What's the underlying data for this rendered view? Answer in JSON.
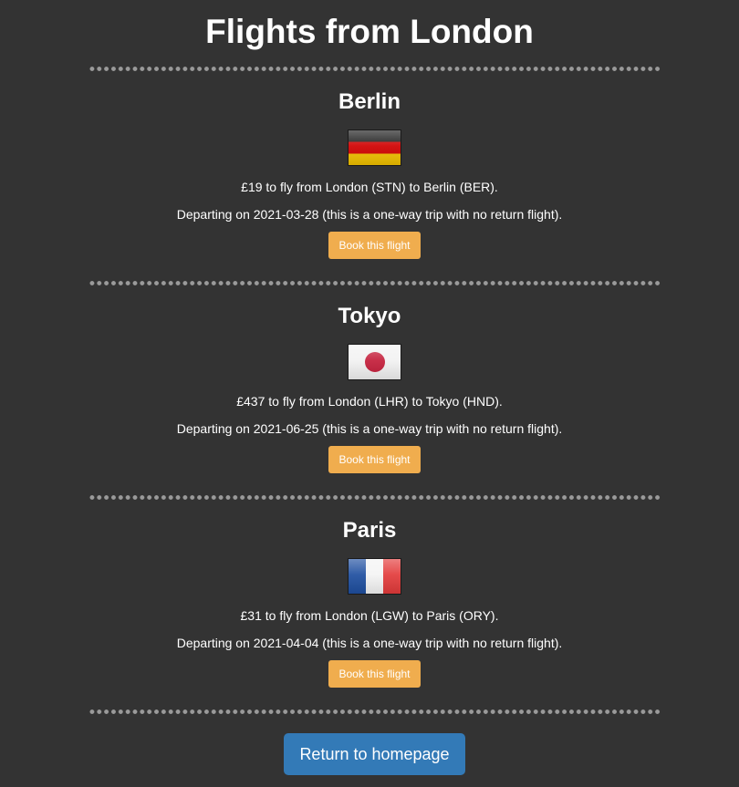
{
  "page": {
    "title": "Flights from London"
  },
  "flights": [
    {
      "city": "Berlin",
      "flag_icon": "germany-flag-icon",
      "price_text": "£19 to fly from London (STN) to Berlin (BER).",
      "departure_text": "Departing on 2021-03-28 (this is a one-way trip with no return flight).",
      "book_label": "Book this flight"
    },
    {
      "city": "Tokyo",
      "flag_icon": "japan-flag-icon",
      "price_text": "£437 to fly from London (LHR) to Tokyo (HND).",
      "departure_text": "Departing on 2021-06-25 (this is a one-way trip with no return flight).",
      "book_label": "Book this flight"
    },
    {
      "city": "Paris",
      "flag_icon": "france-flag-icon",
      "price_text": "£31 to fly from London (LGW) to Paris (ORY).",
      "departure_text": "Departing on 2021-04-04 (this is a one-way trip with no return flight).",
      "book_label": "Book this flight"
    }
  ],
  "footer": {
    "home_label": "Return to homepage"
  },
  "colors": {
    "background": "#333333",
    "book_button": "#f0ad4e",
    "home_button": "#337ab7",
    "divider_dots": "#9a9a9a"
  }
}
